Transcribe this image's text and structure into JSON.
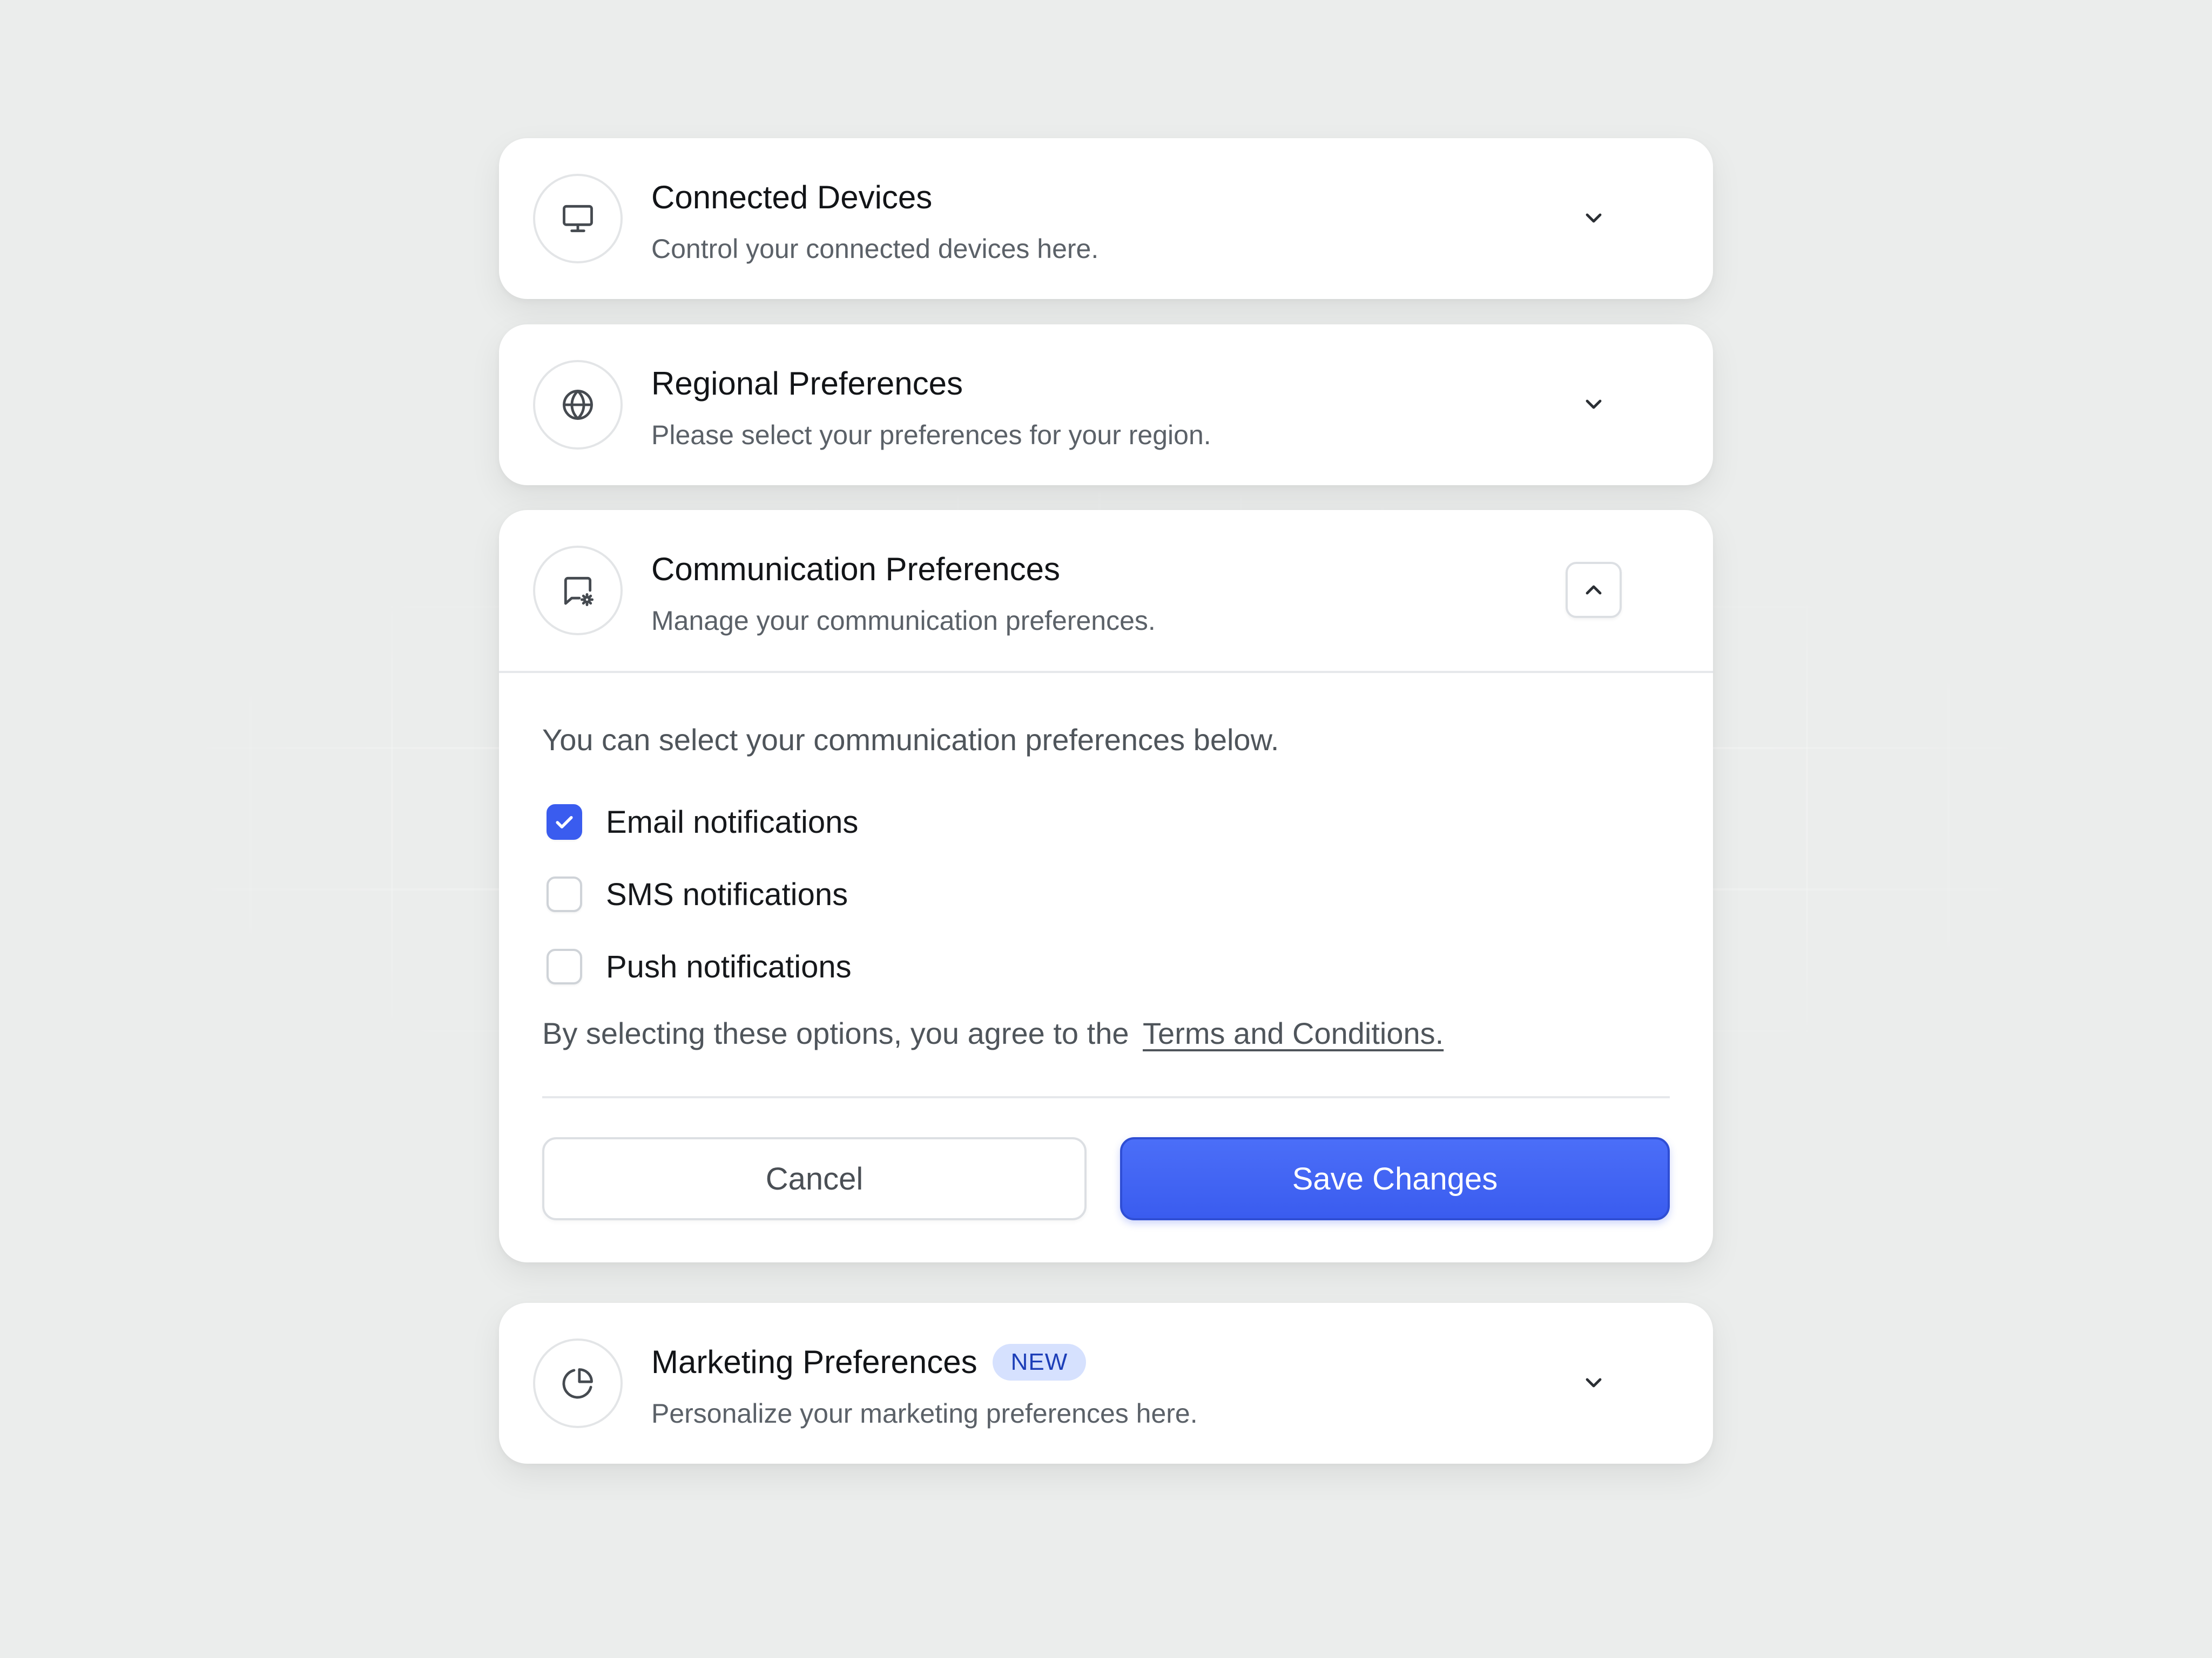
{
  "accordion": {
    "connected_devices": {
      "title": "Connected Devices",
      "subtitle": "Control your connected devices here.",
      "icon": "monitor-icon",
      "expanded": false
    },
    "regional_preferences": {
      "title": "Regional Preferences",
      "subtitle": "Please select your preferences for your region.",
      "icon": "globe-icon",
      "expanded": false
    },
    "communication_preferences": {
      "title": "Communication Preferences",
      "subtitle": "Manage your communication preferences.",
      "icon": "message-settings-icon",
      "expanded": true,
      "intro": "You can select your communication preferences below.",
      "options": [
        {
          "label": "Email notifications",
          "checked": true
        },
        {
          "label": "SMS notifications",
          "checked": false
        },
        {
          "label": "Push notifications",
          "checked": false
        }
      ],
      "terms_prefix": "By selecting these options, you agree to the",
      "terms_link": "Terms and Conditions.",
      "cancel_label": "Cancel",
      "save_label": "Save Changes"
    },
    "marketing_preferences": {
      "title": "Marketing Preferences",
      "badge": "NEW",
      "subtitle": "Personalize your marketing preferences here.",
      "icon": "pie-chart-icon",
      "expanded": false
    }
  },
  "colors": {
    "background": "#ebedec",
    "accent": "#3a5cef",
    "badge_bg": "#d6e1fe",
    "badge_text": "#1d3fb8"
  }
}
